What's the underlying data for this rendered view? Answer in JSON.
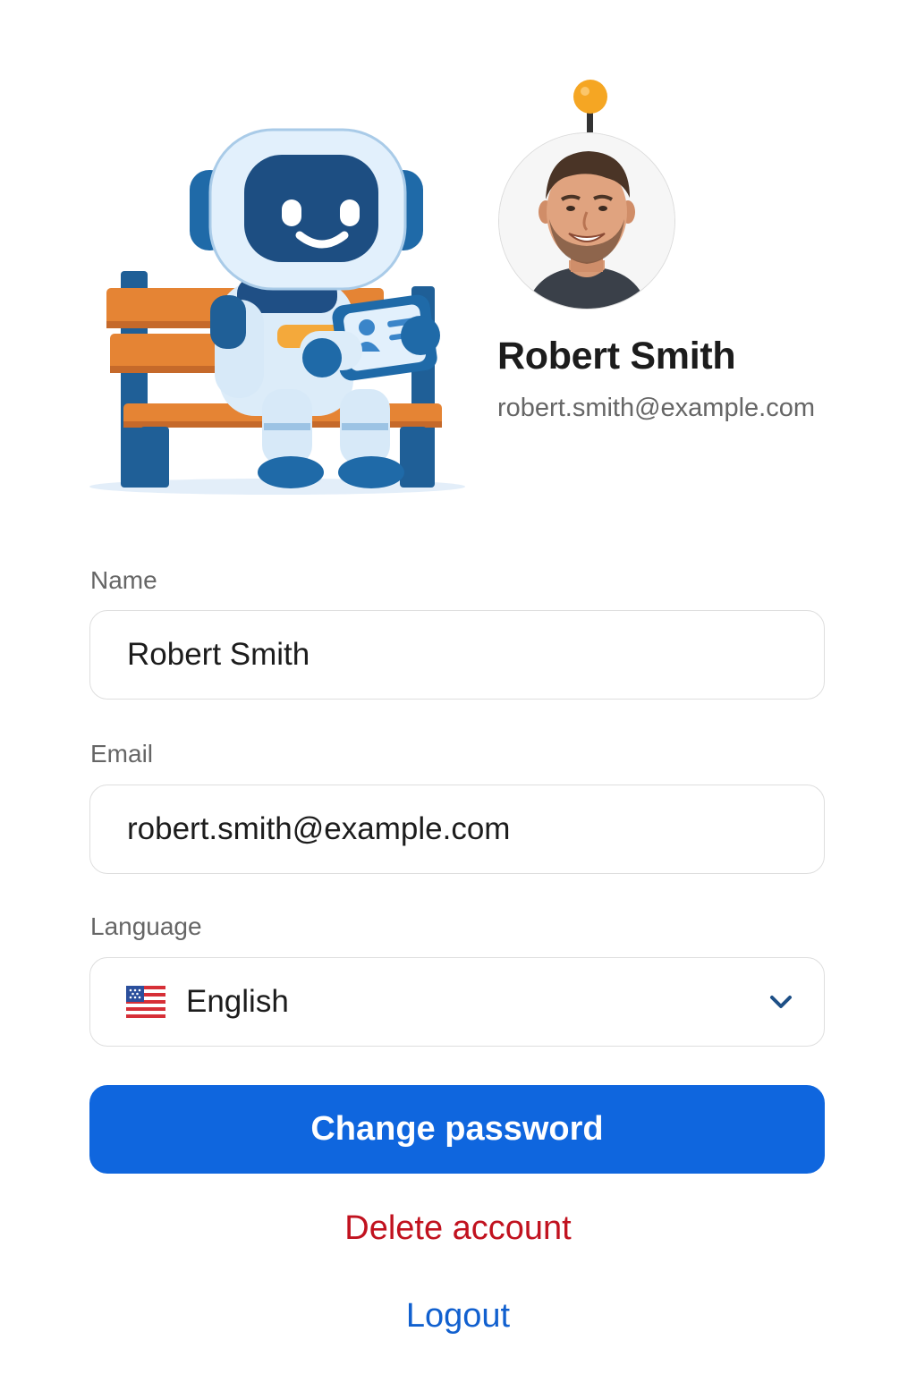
{
  "profile": {
    "name": "Robert Smith",
    "email": "robert.smith@example.com"
  },
  "form": {
    "name_label": "Name",
    "name_value": "Robert Smith",
    "email_label": "Email",
    "email_value": "robert.smith@example.com",
    "language_label": "Language",
    "language_value": "English",
    "language_flag_icon": "us-flag-icon"
  },
  "actions": {
    "change_password": "Change password",
    "delete_account": "Delete account",
    "logout": "Logout"
  },
  "colors": {
    "primary": "#0f66de",
    "danger": "#c1121f",
    "link": "#1160cf"
  }
}
